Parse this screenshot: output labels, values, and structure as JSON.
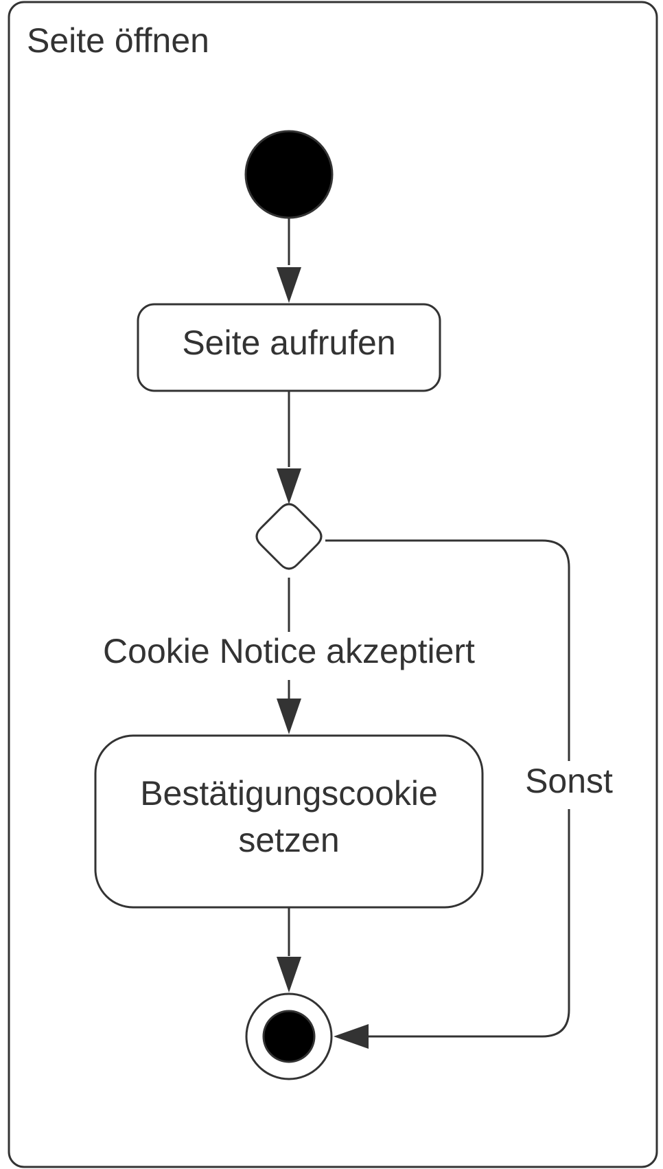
{
  "frame": {
    "title": "Seite öffnen"
  },
  "nodes": {
    "start": {
      "kind": "initial"
    },
    "action_open": {
      "kind": "action",
      "label": "Seite aufrufen"
    },
    "decision": {
      "kind": "decision"
    },
    "action_cookie": {
      "kind": "action",
      "label_line1": "Bestätigungscookie",
      "label_line2": "setzen"
    },
    "end": {
      "kind": "final"
    }
  },
  "edges": {
    "accepted_guard": "Cookie Notice akzeptiert",
    "else_guard": "Sonst"
  },
  "colors": {
    "stroke": "#333333",
    "fill_dark": "#000000",
    "background": "#ffffff"
  }
}
